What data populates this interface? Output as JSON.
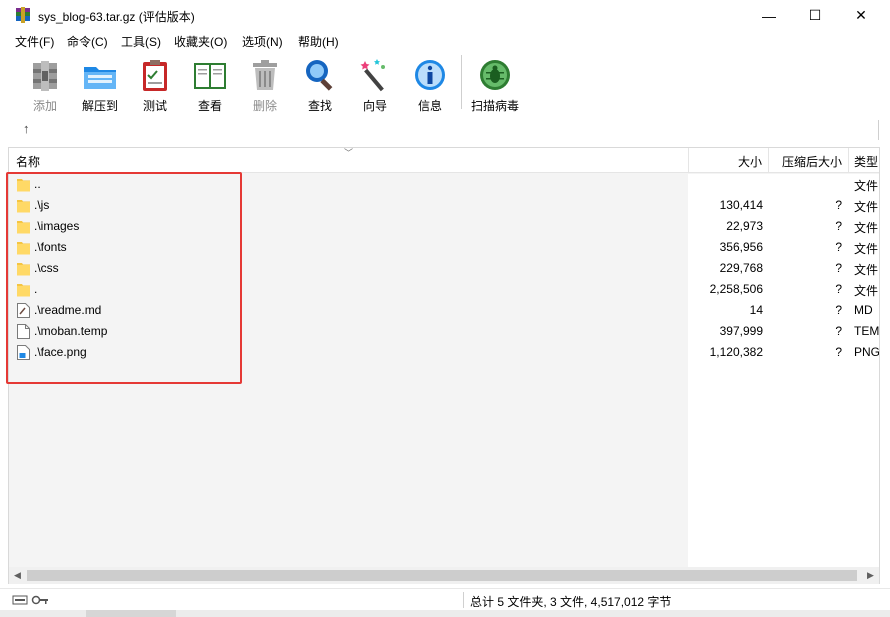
{
  "window": {
    "title": "sys_blog-63.tar.gz (评估版本)",
    "controls": {
      "minimize": "—",
      "maximize": "☐",
      "close": "✕"
    }
  },
  "menu": [
    {
      "label": "文件(F)"
    },
    {
      "label": "命令(C)"
    },
    {
      "label": "工具(S)"
    },
    {
      "label": "收藏夹(O)"
    },
    {
      "label": "选项(N)"
    },
    {
      "label": "帮助(H)"
    }
  ],
  "toolbar": {
    "tools": [
      {
        "label": "添加",
        "icon": "add-archive-icon",
        "disabled": true
      },
      {
        "label": "解压到",
        "icon": "extract-folder-icon",
        "disabled": false
      },
      {
        "label": "测试",
        "icon": "test-clipboard-icon",
        "disabled": false
      },
      {
        "label": "查看",
        "icon": "view-book-icon",
        "disabled": false
      },
      {
        "label": "删除",
        "icon": "delete-trash-icon",
        "disabled": true
      },
      {
        "label": "查找",
        "icon": "find-magnifier-icon",
        "disabled": false
      },
      {
        "label": "向导",
        "icon": "wizard-wand-icon",
        "disabled": false
      },
      {
        "label": "信息",
        "icon": "info-icon",
        "disabled": false
      },
      {
        "label": "扫描病毒",
        "icon": "virus-scan-icon",
        "disabled": false
      }
    ],
    "up_arrow": "↑"
  },
  "list": {
    "headers": {
      "name": "名称",
      "size": "大小",
      "packed": "压缩后大小",
      "type": "类型"
    },
    "rows": [
      {
        "name": "..",
        "size": "",
        "packed": "",
        "type": "文件",
        "kind": "folder"
      },
      {
        "name": ".\\js",
        "size": "130,414",
        "packed": "?",
        "type": "文件",
        "kind": "folder"
      },
      {
        "name": ".\\images",
        "size": "22,973",
        "packed": "?",
        "type": "文件",
        "kind": "folder"
      },
      {
        "name": ".\\fonts",
        "size": "356,956",
        "packed": "?",
        "type": "文件",
        "kind": "folder"
      },
      {
        "name": ".\\css",
        "size": "229,768",
        "packed": "?",
        "type": "文件",
        "kind": "folder"
      },
      {
        "name": ".",
        "size": "2,258,506",
        "packed": "?",
        "type": "文件",
        "kind": "folder"
      },
      {
        "name": ".\\readme.md",
        "size": "14",
        "packed": "?",
        "type": "MD",
        "kind": "md"
      },
      {
        "name": ".\\moban.temp",
        "size": "397,999",
        "packed": "?",
        "type": "TEM",
        "kind": "file"
      },
      {
        "name": ".\\face.png",
        "size": "1,120,382",
        "packed": "?",
        "type": "PNG",
        "kind": "png"
      }
    ]
  },
  "scrollbar": {
    "left": "◀",
    "right": "▶"
  },
  "status": {
    "summary": "总计 5 文件夹, 3 文件, 4,517,012 字节"
  },
  "colors": {
    "highlight": "#e53935",
    "folder": "#f5c542",
    "selection": "#cce8ff"
  }
}
